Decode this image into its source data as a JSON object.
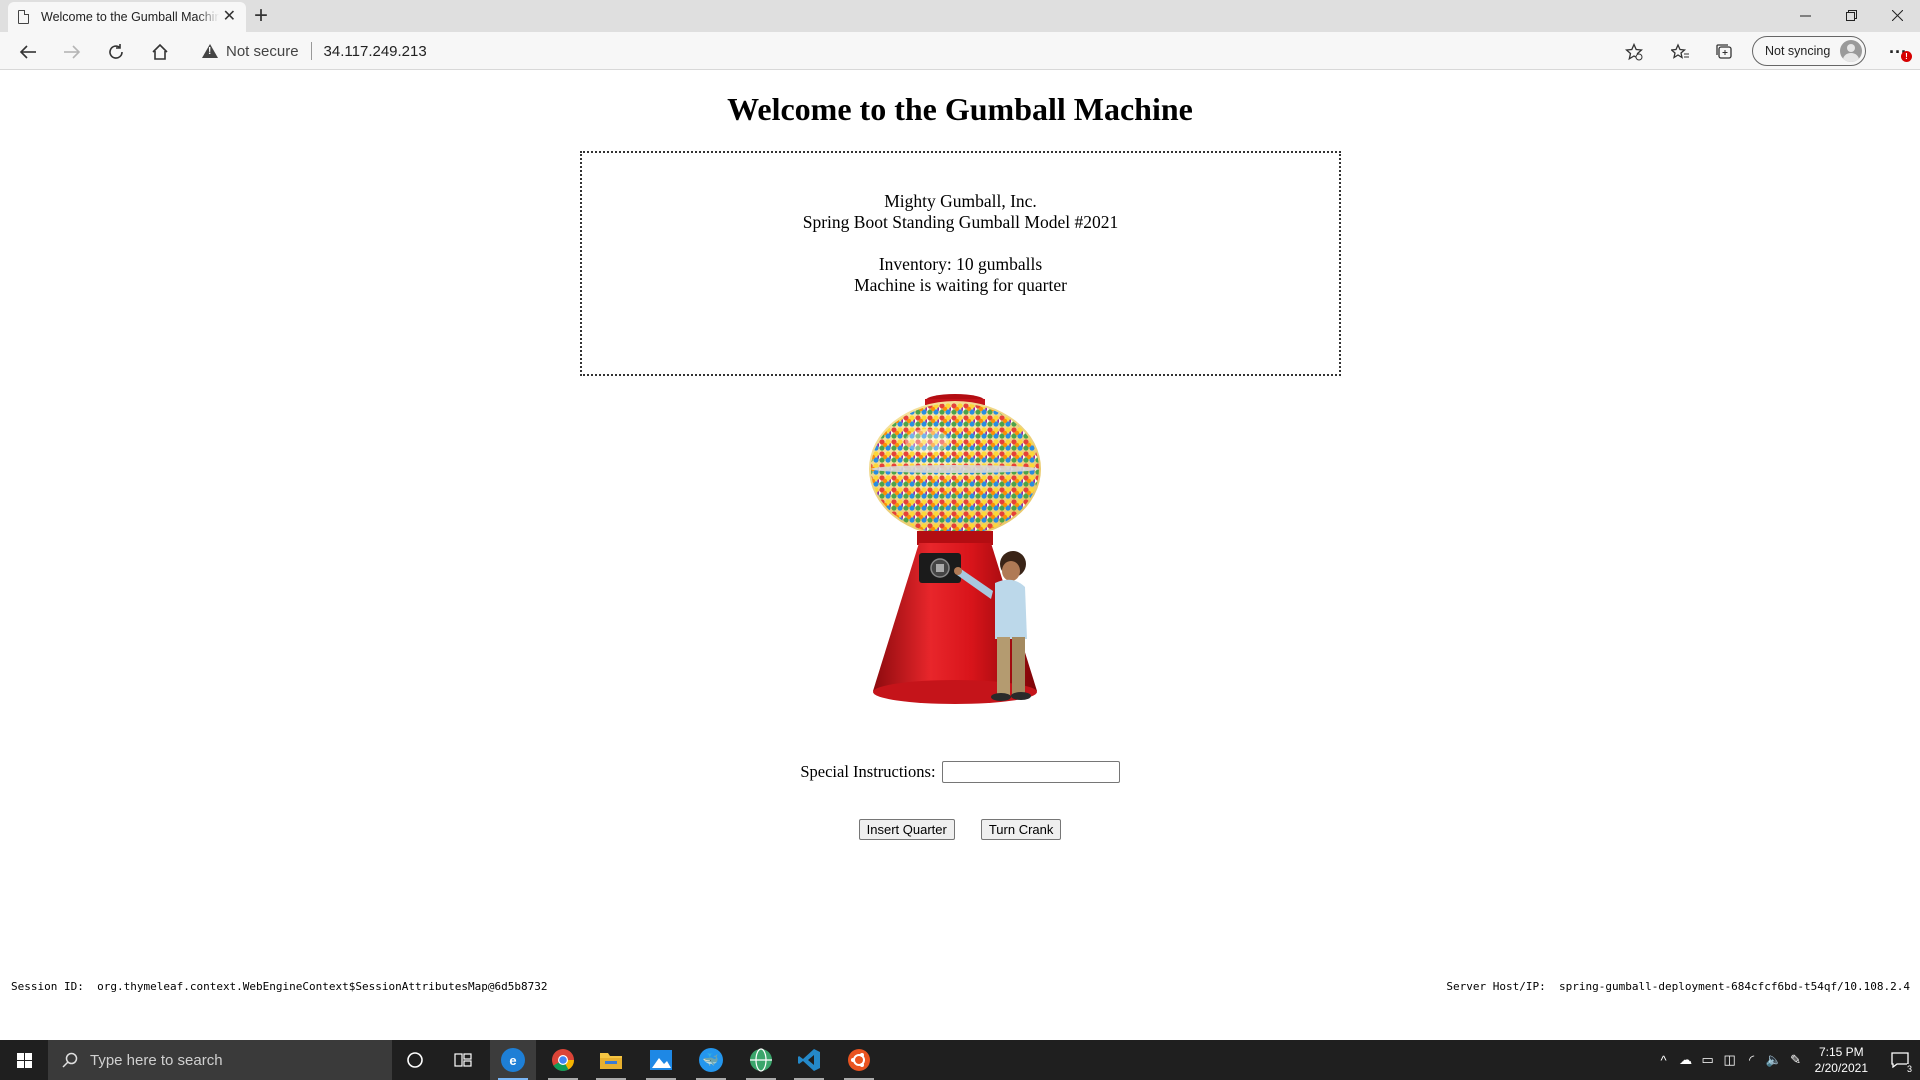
{
  "browser": {
    "tab_title": "Welcome to the Gumball Machine",
    "new_tab_symbol": "+",
    "close_symbol": "✕",
    "security_label": "Not secure",
    "url": "34.117.249.213",
    "sync_label": "Not syncing",
    "more_symbol": "···",
    "more_badge": "!"
  },
  "page": {
    "title": "Welcome to the Gumball Machine",
    "company": "Mighty Gumball, Inc.",
    "model": "Spring Boot Standing Gumball Model #2021",
    "inventory": "Inventory: 10 gumballs",
    "state": "Machine is waiting for quarter",
    "instructions_label": "Special Instructions:",
    "instructions_value": "",
    "insert_quarter_label": "Insert Quarter",
    "turn_crank_label": "Turn Crank",
    "session_label": "Session ID:",
    "session_value": "org.thymeleaf.context.WebEngineContext$SessionAttributesMap@6d5b8732",
    "server_label": "Server Host/IP:",
    "server_value": "spring-gumball-deployment-684cfcf6bd-t54qf/10.108.2.4"
  },
  "taskbar": {
    "search_placeholder": "Type here to search",
    "time": "7:15 PM",
    "date": "2/20/2021",
    "notification_count": "3"
  },
  "colors": {
    "machine_red": "#d8141a",
    "edge_blue": "#1e7fd6",
    "vscode_blue": "#2489ca",
    "ubuntu_orange": "#e95420"
  }
}
